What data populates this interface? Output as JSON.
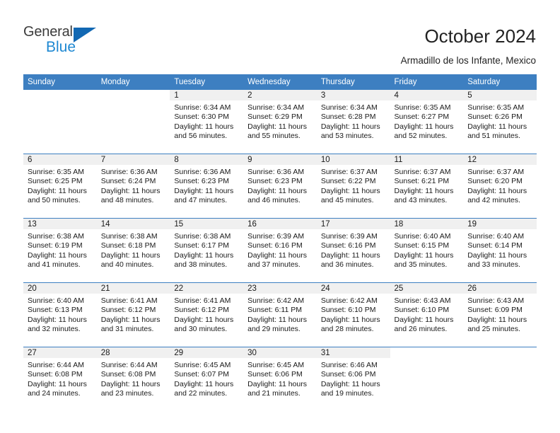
{
  "branding": {
    "logo_text_general": "General",
    "logo_text_blue": "Blue",
    "accent_color": "#3d7fc1",
    "logo_blue_color": "#1e88d2"
  },
  "header": {
    "title": "October 2024",
    "location": "Armadillo de los Infante, Mexico"
  },
  "weekday_headers": [
    "Sunday",
    "Monday",
    "Tuesday",
    "Wednesday",
    "Thursday",
    "Friday",
    "Saturday"
  ],
  "labels": {
    "sunrise_prefix": "Sunrise:",
    "sunset_prefix": "Sunset:",
    "daylight_prefix": "Daylight:"
  },
  "weeks": [
    [
      {
        "day": "",
        "blank": true
      },
      {
        "day": "",
        "blank": true
      },
      {
        "day": "1",
        "sunrise": "Sunrise: 6:34 AM",
        "sunset": "Sunset: 6:30 PM",
        "daylight_line1": "Daylight: 11 hours",
        "daylight_line2": "and 56 minutes."
      },
      {
        "day": "2",
        "sunrise": "Sunrise: 6:34 AM",
        "sunset": "Sunset: 6:29 PM",
        "daylight_line1": "Daylight: 11 hours",
        "daylight_line2": "and 55 minutes."
      },
      {
        "day": "3",
        "sunrise": "Sunrise: 6:34 AM",
        "sunset": "Sunset: 6:28 PM",
        "daylight_line1": "Daylight: 11 hours",
        "daylight_line2": "and 53 minutes."
      },
      {
        "day": "4",
        "sunrise": "Sunrise: 6:35 AM",
        "sunset": "Sunset: 6:27 PM",
        "daylight_line1": "Daylight: 11 hours",
        "daylight_line2": "and 52 minutes."
      },
      {
        "day": "5",
        "sunrise": "Sunrise: 6:35 AM",
        "sunset": "Sunset: 6:26 PM",
        "daylight_line1": "Daylight: 11 hours",
        "daylight_line2": "and 51 minutes."
      }
    ],
    [
      {
        "day": "6",
        "sunrise": "Sunrise: 6:35 AM",
        "sunset": "Sunset: 6:25 PM",
        "daylight_line1": "Daylight: 11 hours",
        "daylight_line2": "and 50 minutes."
      },
      {
        "day": "7",
        "sunrise": "Sunrise: 6:36 AM",
        "sunset": "Sunset: 6:24 PM",
        "daylight_line1": "Daylight: 11 hours",
        "daylight_line2": "and 48 minutes."
      },
      {
        "day": "8",
        "sunrise": "Sunrise: 6:36 AM",
        "sunset": "Sunset: 6:23 PM",
        "daylight_line1": "Daylight: 11 hours",
        "daylight_line2": "and 47 minutes."
      },
      {
        "day": "9",
        "sunrise": "Sunrise: 6:36 AM",
        "sunset": "Sunset: 6:23 PM",
        "daylight_line1": "Daylight: 11 hours",
        "daylight_line2": "and 46 minutes."
      },
      {
        "day": "10",
        "sunrise": "Sunrise: 6:37 AM",
        "sunset": "Sunset: 6:22 PM",
        "daylight_line1": "Daylight: 11 hours",
        "daylight_line2": "and 45 minutes."
      },
      {
        "day": "11",
        "sunrise": "Sunrise: 6:37 AM",
        "sunset": "Sunset: 6:21 PM",
        "daylight_line1": "Daylight: 11 hours",
        "daylight_line2": "and 43 minutes."
      },
      {
        "day": "12",
        "sunrise": "Sunrise: 6:37 AM",
        "sunset": "Sunset: 6:20 PM",
        "daylight_line1": "Daylight: 11 hours",
        "daylight_line2": "and 42 minutes."
      }
    ],
    [
      {
        "day": "13",
        "sunrise": "Sunrise: 6:38 AM",
        "sunset": "Sunset: 6:19 PM",
        "daylight_line1": "Daylight: 11 hours",
        "daylight_line2": "and 41 minutes."
      },
      {
        "day": "14",
        "sunrise": "Sunrise: 6:38 AM",
        "sunset": "Sunset: 6:18 PM",
        "daylight_line1": "Daylight: 11 hours",
        "daylight_line2": "and 40 minutes."
      },
      {
        "day": "15",
        "sunrise": "Sunrise: 6:38 AM",
        "sunset": "Sunset: 6:17 PM",
        "daylight_line1": "Daylight: 11 hours",
        "daylight_line2": "and 38 minutes."
      },
      {
        "day": "16",
        "sunrise": "Sunrise: 6:39 AM",
        "sunset": "Sunset: 6:16 PM",
        "daylight_line1": "Daylight: 11 hours",
        "daylight_line2": "and 37 minutes."
      },
      {
        "day": "17",
        "sunrise": "Sunrise: 6:39 AM",
        "sunset": "Sunset: 6:16 PM",
        "daylight_line1": "Daylight: 11 hours",
        "daylight_line2": "and 36 minutes."
      },
      {
        "day": "18",
        "sunrise": "Sunrise: 6:40 AM",
        "sunset": "Sunset: 6:15 PM",
        "daylight_line1": "Daylight: 11 hours",
        "daylight_line2": "and 35 minutes."
      },
      {
        "day": "19",
        "sunrise": "Sunrise: 6:40 AM",
        "sunset": "Sunset: 6:14 PM",
        "daylight_line1": "Daylight: 11 hours",
        "daylight_line2": "and 33 minutes."
      }
    ],
    [
      {
        "day": "20",
        "sunrise": "Sunrise: 6:40 AM",
        "sunset": "Sunset: 6:13 PM",
        "daylight_line1": "Daylight: 11 hours",
        "daylight_line2": "and 32 minutes."
      },
      {
        "day": "21",
        "sunrise": "Sunrise: 6:41 AM",
        "sunset": "Sunset: 6:12 PM",
        "daylight_line1": "Daylight: 11 hours",
        "daylight_line2": "and 31 minutes."
      },
      {
        "day": "22",
        "sunrise": "Sunrise: 6:41 AM",
        "sunset": "Sunset: 6:12 PM",
        "daylight_line1": "Daylight: 11 hours",
        "daylight_line2": "and 30 minutes."
      },
      {
        "day": "23",
        "sunrise": "Sunrise: 6:42 AM",
        "sunset": "Sunset: 6:11 PM",
        "daylight_line1": "Daylight: 11 hours",
        "daylight_line2": "and 29 minutes."
      },
      {
        "day": "24",
        "sunrise": "Sunrise: 6:42 AM",
        "sunset": "Sunset: 6:10 PM",
        "daylight_line1": "Daylight: 11 hours",
        "daylight_line2": "and 28 minutes."
      },
      {
        "day": "25",
        "sunrise": "Sunrise: 6:43 AM",
        "sunset": "Sunset: 6:10 PM",
        "daylight_line1": "Daylight: 11 hours",
        "daylight_line2": "and 26 minutes."
      },
      {
        "day": "26",
        "sunrise": "Sunrise: 6:43 AM",
        "sunset": "Sunset: 6:09 PM",
        "daylight_line1": "Daylight: 11 hours",
        "daylight_line2": "and 25 minutes."
      }
    ],
    [
      {
        "day": "27",
        "sunrise": "Sunrise: 6:44 AM",
        "sunset": "Sunset: 6:08 PM",
        "daylight_line1": "Daylight: 11 hours",
        "daylight_line2": "and 24 minutes."
      },
      {
        "day": "28",
        "sunrise": "Sunrise: 6:44 AM",
        "sunset": "Sunset: 6:08 PM",
        "daylight_line1": "Daylight: 11 hours",
        "daylight_line2": "and 23 minutes."
      },
      {
        "day": "29",
        "sunrise": "Sunrise: 6:45 AM",
        "sunset": "Sunset: 6:07 PM",
        "daylight_line1": "Daylight: 11 hours",
        "daylight_line2": "and 22 minutes."
      },
      {
        "day": "30",
        "sunrise": "Sunrise: 6:45 AM",
        "sunset": "Sunset: 6:06 PM",
        "daylight_line1": "Daylight: 11 hours",
        "daylight_line2": "and 21 minutes."
      },
      {
        "day": "31",
        "sunrise": "Sunrise: 6:46 AM",
        "sunset": "Sunset: 6:06 PM",
        "daylight_line1": "Daylight: 11 hours",
        "daylight_line2": "and 19 minutes."
      },
      {
        "day": "",
        "blank": true
      },
      {
        "day": "",
        "blank": true
      }
    ]
  ]
}
